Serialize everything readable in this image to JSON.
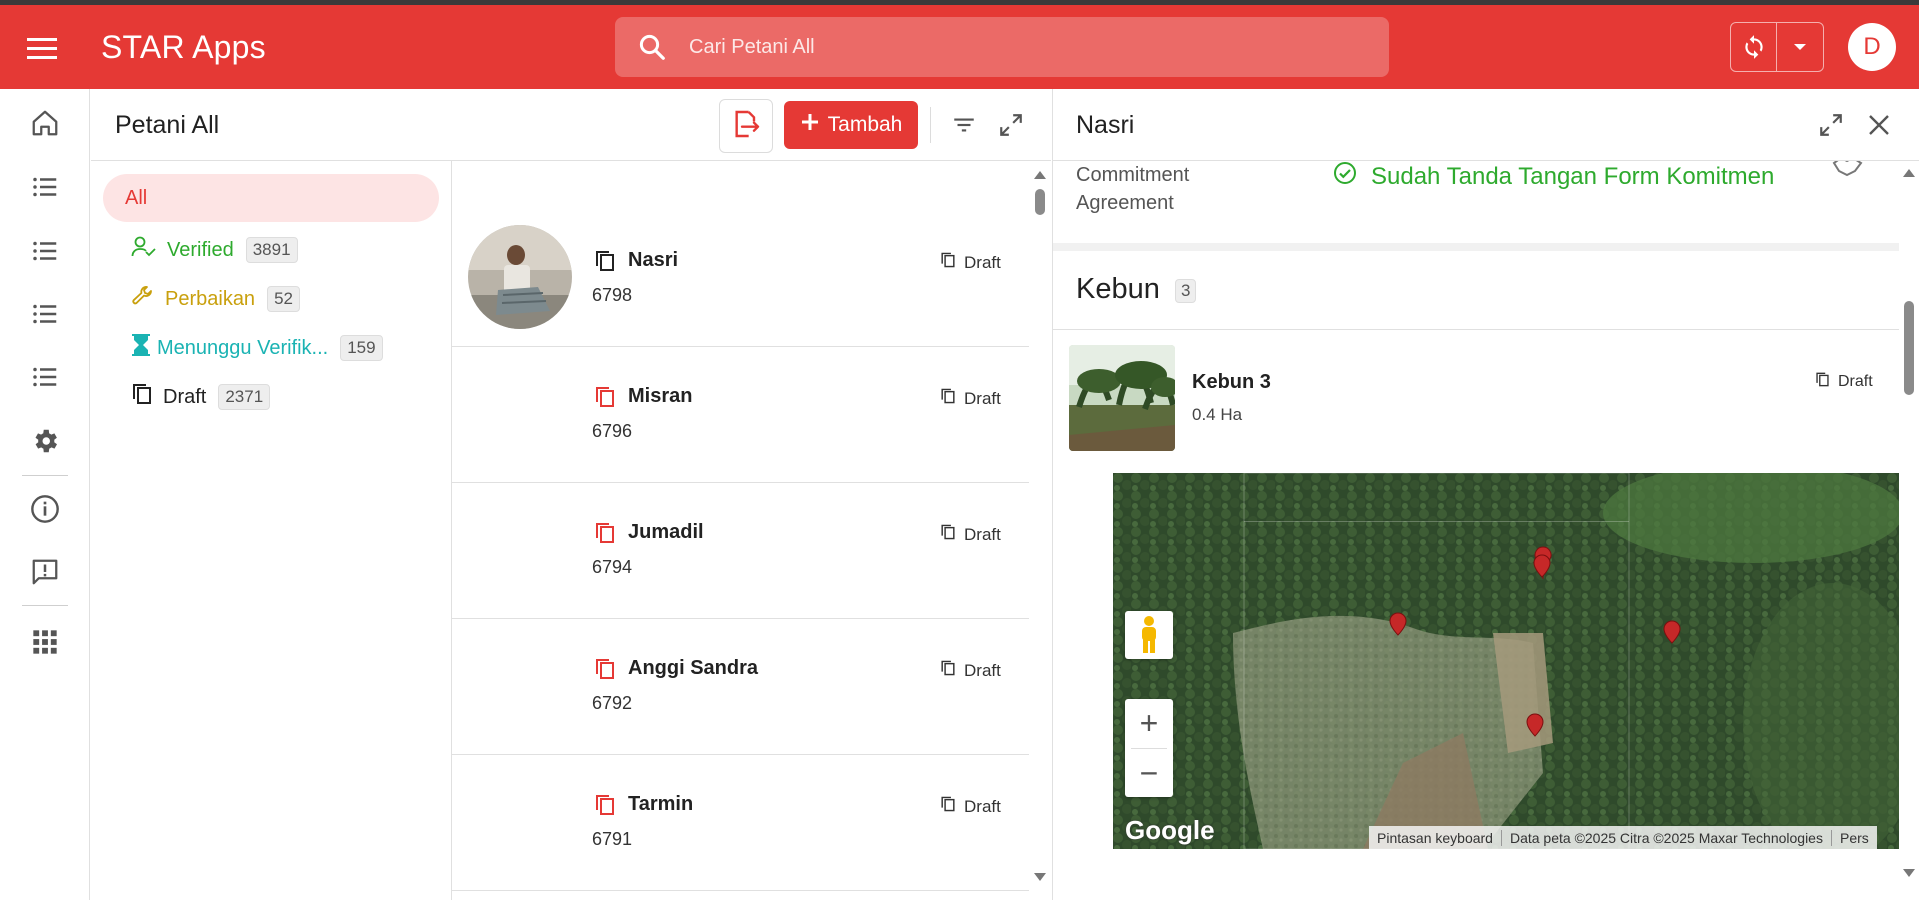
{
  "app": {
    "title": "STAR Apps"
  },
  "search": {
    "placeholder": "Cari Petani All"
  },
  "user": {
    "initial": "D"
  },
  "colors": {
    "primary": "#e53935",
    "verified": "#2eaa2e",
    "repair": "#d4a017",
    "waiting": "#1ab3b3"
  },
  "rail": {
    "items": [
      {
        "icon": "home-icon"
      },
      {
        "icon": "list-icon"
      },
      {
        "icon": "list-icon"
      },
      {
        "icon": "list-icon"
      },
      {
        "icon": "list-icon"
      },
      {
        "icon": "gear-icon"
      },
      {
        "icon": "info-icon"
      },
      {
        "icon": "feedback-icon"
      },
      {
        "icon": "apps-grid-icon"
      }
    ]
  },
  "panel": {
    "title": "Petani All",
    "add_label": "Tambah"
  },
  "filters": [
    {
      "label": "All",
      "count": null
    },
    {
      "label": "Verified",
      "count": "3891"
    },
    {
      "label": "Perbaikan",
      "count": "52"
    },
    {
      "label": "Menunggu Verifik...",
      "count": "159"
    },
    {
      "label": "Draft",
      "count": "2371"
    }
  ],
  "farmers": [
    {
      "name": "Nasri",
      "id": "6798",
      "status": "Draft"
    },
    {
      "name": "Misran",
      "id": "6796",
      "status": "Draft"
    },
    {
      "name": "Jumadil",
      "id": "6794",
      "status": "Draft"
    },
    {
      "name": "Anggi Sandra",
      "id": "6792",
      "status": "Draft"
    },
    {
      "name": "Tarmin",
      "id": "6791",
      "status": "Draft"
    }
  ],
  "detail": {
    "title": "Nasri",
    "commitment": {
      "label_line1": "Commitment",
      "label_line2": "Agreement",
      "value": "Sudah Tanda Tangan Form Komitmen"
    },
    "kebun": {
      "title": "Kebun",
      "count": "3",
      "item": {
        "name": "Kebun 3",
        "size": "0.4 Ha",
        "status": "Draft"
      }
    },
    "map": {
      "logo": "Google",
      "attribution": [
        "Pintasan keyboard",
        "Data peta ©2025 Citra ©2025 Maxar Technologies",
        "Pers"
      ]
    }
  }
}
